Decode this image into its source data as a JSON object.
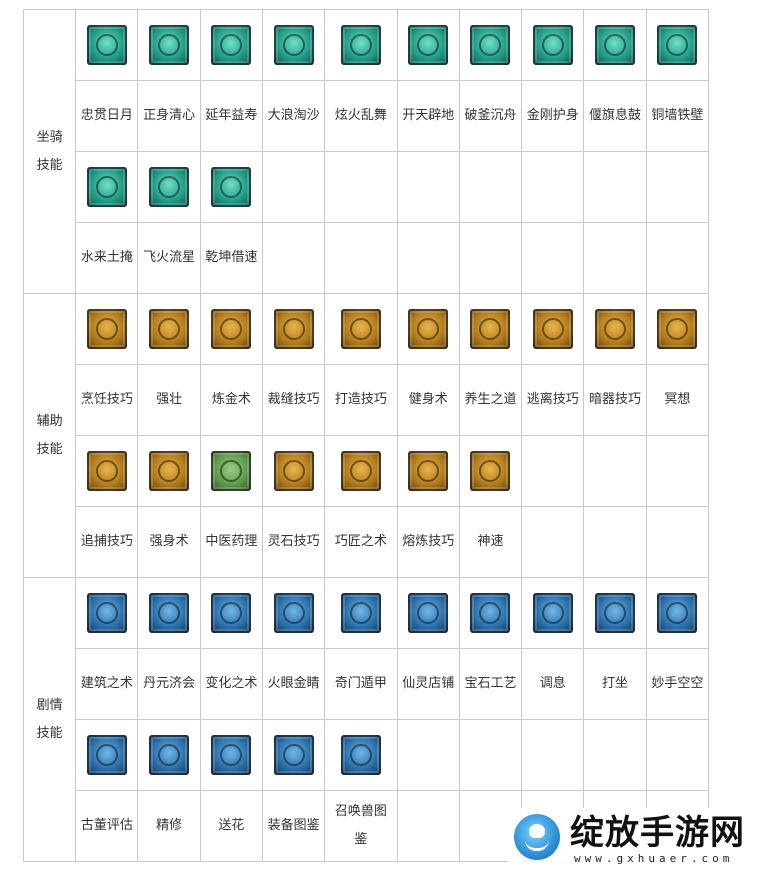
{
  "categories": [
    {
      "label_lines": [
        "坐骑",
        "技能"
      ],
      "color": "#1f9a86",
      "blocks": [
        {
          "icons": [
            "teal-sun-icon",
            "teal-drop-icon",
            "teal-glyph-icon",
            "teal-wave-icon",
            "teal-flame-icon",
            "teal-sword-icon",
            "teal-blades-icon",
            "teal-buddha-icon",
            "teal-banner-icon",
            "teal-wall-icon"
          ],
          "icon_styles": [
            "teal",
            "teal",
            "teal",
            "teal",
            "teal",
            "teal",
            "teal",
            "teal",
            "teal",
            "teal"
          ],
          "names": [
            "忠贯日月",
            "正身清心",
            "延年益寿",
            "大浪淘沙",
            "炫火乱舞",
            "开天辟地",
            "破釜沉舟",
            "金刚护身",
            "偃旗息鼓",
            "铜墙铁壁"
          ]
        },
        {
          "icons": [
            "teal-swirl-icon",
            "teal-meteor-icon",
            "teal-yinyang-icon"
          ],
          "icon_styles": [
            "teal",
            "teal",
            "teal"
          ],
          "names": [
            "水来土掩",
            "飞火流星",
            "乾坤借速"
          ]
        }
      ]
    },
    {
      "label_lines": [
        "辅助",
        "技能"
      ],
      "color": "#b07a1c",
      "blocks": [
        {
          "icons": [
            "gold-pot-icon",
            "gold-muscle-icon",
            "gold-alchemy-icon",
            "gold-scissors-icon",
            "gold-hammer-icon",
            "gold-fitness-icon",
            "gold-longevity-icon",
            "gold-escape-icon",
            "gold-dart-icon",
            "gold-meditate-icon"
          ],
          "icon_styles": [
            "gold",
            "gold",
            "gold",
            "gold",
            "gold",
            "gold",
            "gold",
            "gold",
            "gold",
            "gold"
          ],
          "names": [
            "烹饪技巧",
            "强壮",
            "炼金术",
            "裁缝技巧",
            "打造技巧",
            "健身术",
            "养生之道",
            "逃离技巧",
            "暗器技巧",
            "冥想"
          ]
        },
        {
          "icons": [
            "gold-chase-icon",
            "gold-strong-icon",
            "green-herb-icon",
            "gold-gem-icon",
            "gold-craft-icon",
            "gold-smelt-icon",
            "gold-speed-icon"
          ],
          "icon_styles": [
            "gold",
            "gold",
            "green",
            "gold",
            "gold",
            "gold",
            "gold"
          ],
          "names": [
            "追捕技巧",
            "强身术",
            "中医药理",
            "灵石技巧",
            "巧匠之术",
            "熔炼技巧",
            "神速"
          ]
        }
      ]
    },
    {
      "label_lines": [
        "剧情",
        "技能"
      ],
      "color": "#2a6fa8",
      "blocks": [
        {
          "icons": [
            "blue-building-icon",
            "blue-pill-icon",
            "blue-change-icon",
            "blue-eye-icon",
            "blue-maze-icon",
            "blue-shop-icon",
            "blue-gem-icon",
            "blue-breath-icon",
            "blue-sit-icon",
            "blue-hand-icon"
          ],
          "icon_styles": [
            "blue",
            "blue",
            "blue",
            "blue",
            "blue",
            "blue",
            "blue",
            "blue",
            "blue",
            "blue"
          ],
          "names": [
            "建筑之术",
            "丹元济会",
            "变化之术",
            "火眼金睛",
            "奇门遁甲",
            "仙灵店铺",
            "宝石工艺",
            "调息",
            "打坐",
            "妙手空空"
          ]
        },
        {
          "icons": [
            "blue-antique-icon",
            "blue-repair-icon",
            "blue-flower-icon",
            "blue-gear-book-icon",
            "blue-pet-book-icon"
          ],
          "icon_styles": [
            "blue",
            "blue",
            "blue",
            "blue",
            "blue"
          ],
          "names": [
            "古董评估",
            "精修",
            "送花",
            "装备图鉴",
            "召唤兽图鉴"
          ]
        }
      ]
    }
  ],
  "watermark": {
    "title": "绽放手游网",
    "url": "www.gxhuaer.com"
  }
}
